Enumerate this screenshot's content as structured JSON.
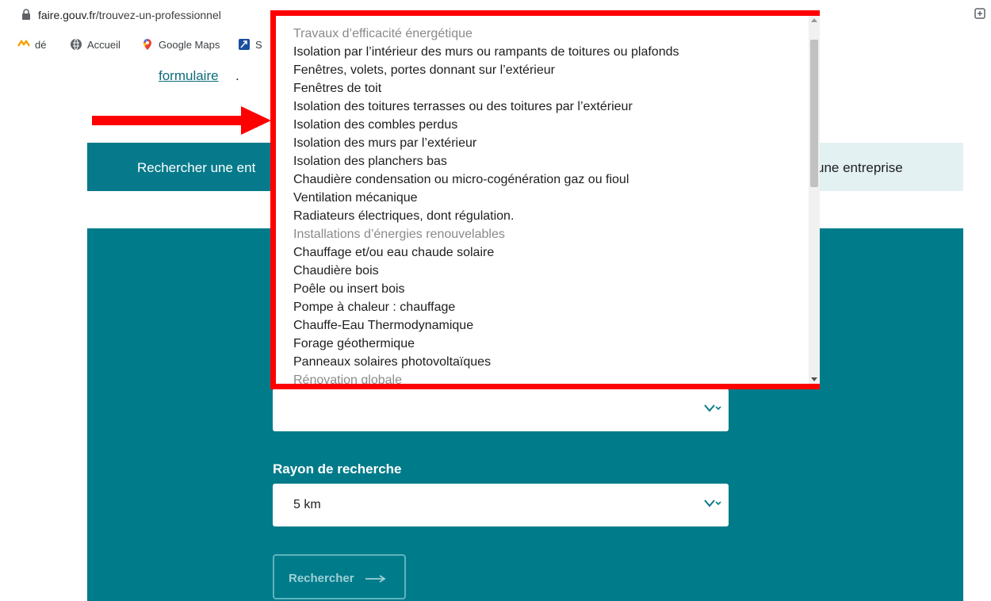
{
  "browser": {
    "url_domain": "faire.gouv.fr",
    "url_path": "/trouvez-un-professionnel",
    "bookmarks": [
      {
        "label": "dé",
        "icon": "bookmark-app-icon"
      },
      {
        "label": "Accueil",
        "icon": "globe-icon"
      },
      {
        "label": "Google Maps",
        "icon": "maps-pin-icon"
      },
      {
        "label": "S",
        "icon": "bookmark-icon"
      }
    ]
  },
  "page": {
    "formulaire_link": "formulaire",
    "formulaire_suffix": ".",
    "tab_left": "Rechercher une ent",
    "tab_right": "une entreprise",
    "rayon_label": "Rayon de recherche",
    "rayon_value": "5 km",
    "search_button": "Rechercher"
  },
  "dropdown": {
    "options": [
      {
        "label": "Travaux d’efficacité énergétique",
        "group": true
      },
      {
        "label": "Isolation par l’intérieur des murs ou rampants de toitures ou plafonds",
        "group": false
      },
      {
        "label": "Fenêtres, volets, portes donnant sur l’extérieur",
        "group": false
      },
      {
        "label": "Fenêtres de toit",
        "group": false
      },
      {
        "label": "Isolation des toitures terrasses ou des toitures par l’extérieur",
        "group": false
      },
      {
        "label": "Isolation des combles perdus",
        "group": false
      },
      {
        "label": "Isolation des murs par l’extérieur",
        "group": false
      },
      {
        "label": "Isolation des planchers bas",
        "group": false
      },
      {
        "label": "Chaudière condensation ou micro-cogénération gaz ou fioul",
        "group": false
      },
      {
        "label": "Ventilation mécanique",
        "group": false
      },
      {
        "label": "Radiateurs électriques, dont régulation.",
        "group": false
      },
      {
        "label": "Installations d’énergies renouvelables",
        "group": true
      },
      {
        "label": "Chauffage et/ou eau chaude solaire",
        "group": false
      },
      {
        "label": "Chaudière bois",
        "group": false
      },
      {
        "label": "Poêle ou insert bois",
        "group": false
      },
      {
        "label": "Pompe à chaleur : chauffage",
        "group": false
      },
      {
        "label": "Chauffe-Eau Thermodynamique",
        "group": false
      },
      {
        "label": "Forage géothermique",
        "group": false
      },
      {
        "label": "Panneaux solaires photovoltaïques",
        "group": false
      },
      {
        "label": "Rénovation globale",
        "group": true
      }
    ]
  },
  "colors": {
    "teal": "#007b8a",
    "highlight_border": "#ff0000",
    "arrow": "#ff0000"
  }
}
